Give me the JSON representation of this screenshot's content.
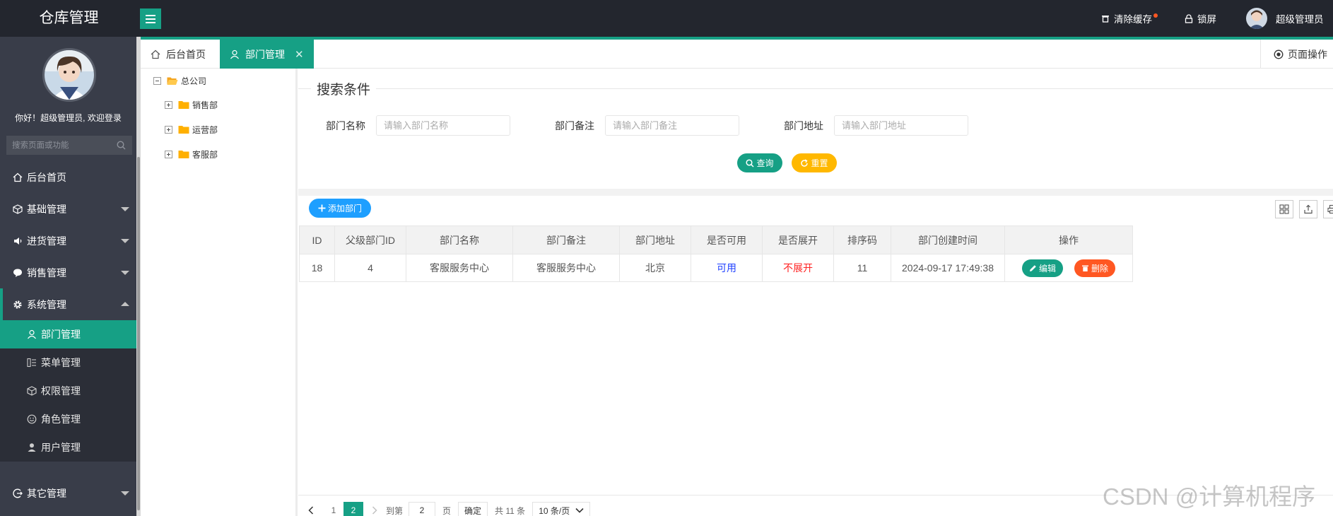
{
  "header": {
    "logo": "仓库管理",
    "clear_cache": "清除缓存",
    "lock_screen": "锁屏",
    "user_name": "超级管理员"
  },
  "sidebar": {
    "welcome": "你好！超级管理员, 欢迎登录",
    "search_placeholder": "搜索页面或功能",
    "items": [
      {
        "label": "后台首页"
      },
      {
        "label": "基础管理"
      },
      {
        "label": "进货管理"
      },
      {
        "label": "销售管理"
      },
      {
        "label": "系统管理"
      },
      {
        "label": "其它管理"
      }
    ],
    "sub_items": [
      {
        "label": "部门管理"
      },
      {
        "label": "菜单管理"
      },
      {
        "label": "权限管理"
      },
      {
        "label": "角色管理"
      },
      {
        "label": "用户管理"
      }
    ]
  },
  "tabs": {
    "home": "后台首页",
    "dept": "部门管理",
    "close": "✕",
    "page_ops": "页面操作"
  },
  "tree": {
    "root": "总公司",
    "children": [
      "销售部",
      "运营部",
      "客服部"
    ]
  },
  "search": {
    "legend": "搜索条件",
    "name_label": "部门名称",
    "name_placeholder": "请输入部门名称",
    "remark_label": "部门备注",
    "remark_placeholder": "请输入部门备注",
    "address_label": "部门地址",
    "address_placeholder": "请输入部门地址",
    "query_btn": "查询",
    "reset_btn": "重置"
  },
  "toolbar": {
    "add_btn": "添加部门"
  },
  "table": {
    "columns": [
      "ID",
      "父级部门ID",
      "部门名称",
      "部门备注",
      "部门地址",
      "是否可用",
      "是否展开",
      "排序码",
      "部门创建时间",
      "操作"
    ],
    "rows": [
      {
        "id": "18",
        "pid": "4",
        "name": "客服服务中心",
        "remark": "客服服务中心",
        "address": "北京",
        "available": "可用",
        "open": "不展开",
        "ordernum": "11",
        "createtime": "2024-09-17 17:49:38",
        "edit": "编辑",
        "delete": "删除"
      }
    ]
  },
  "pager": {
    "pages": [
      "1",
      "2"
    ],
    "current": "2",
    "goto_label": "到第",
    "goto_value": "2",
    "page_unit": "页",
    "confirm": "确定",
    "total": "共 11 条",
    "page_size": "10 条/页"
  },
  "watermark": "CSDN @计算机程序",
  "colors": {
    "accent": "#16a085",
    "header_bg": "#23262e",
    "sidebar_bg": "#393d49",
    "reset": "#ffb800",
    "add": "#1e9fff",
    "delete": "#ff5722"
  }
}
